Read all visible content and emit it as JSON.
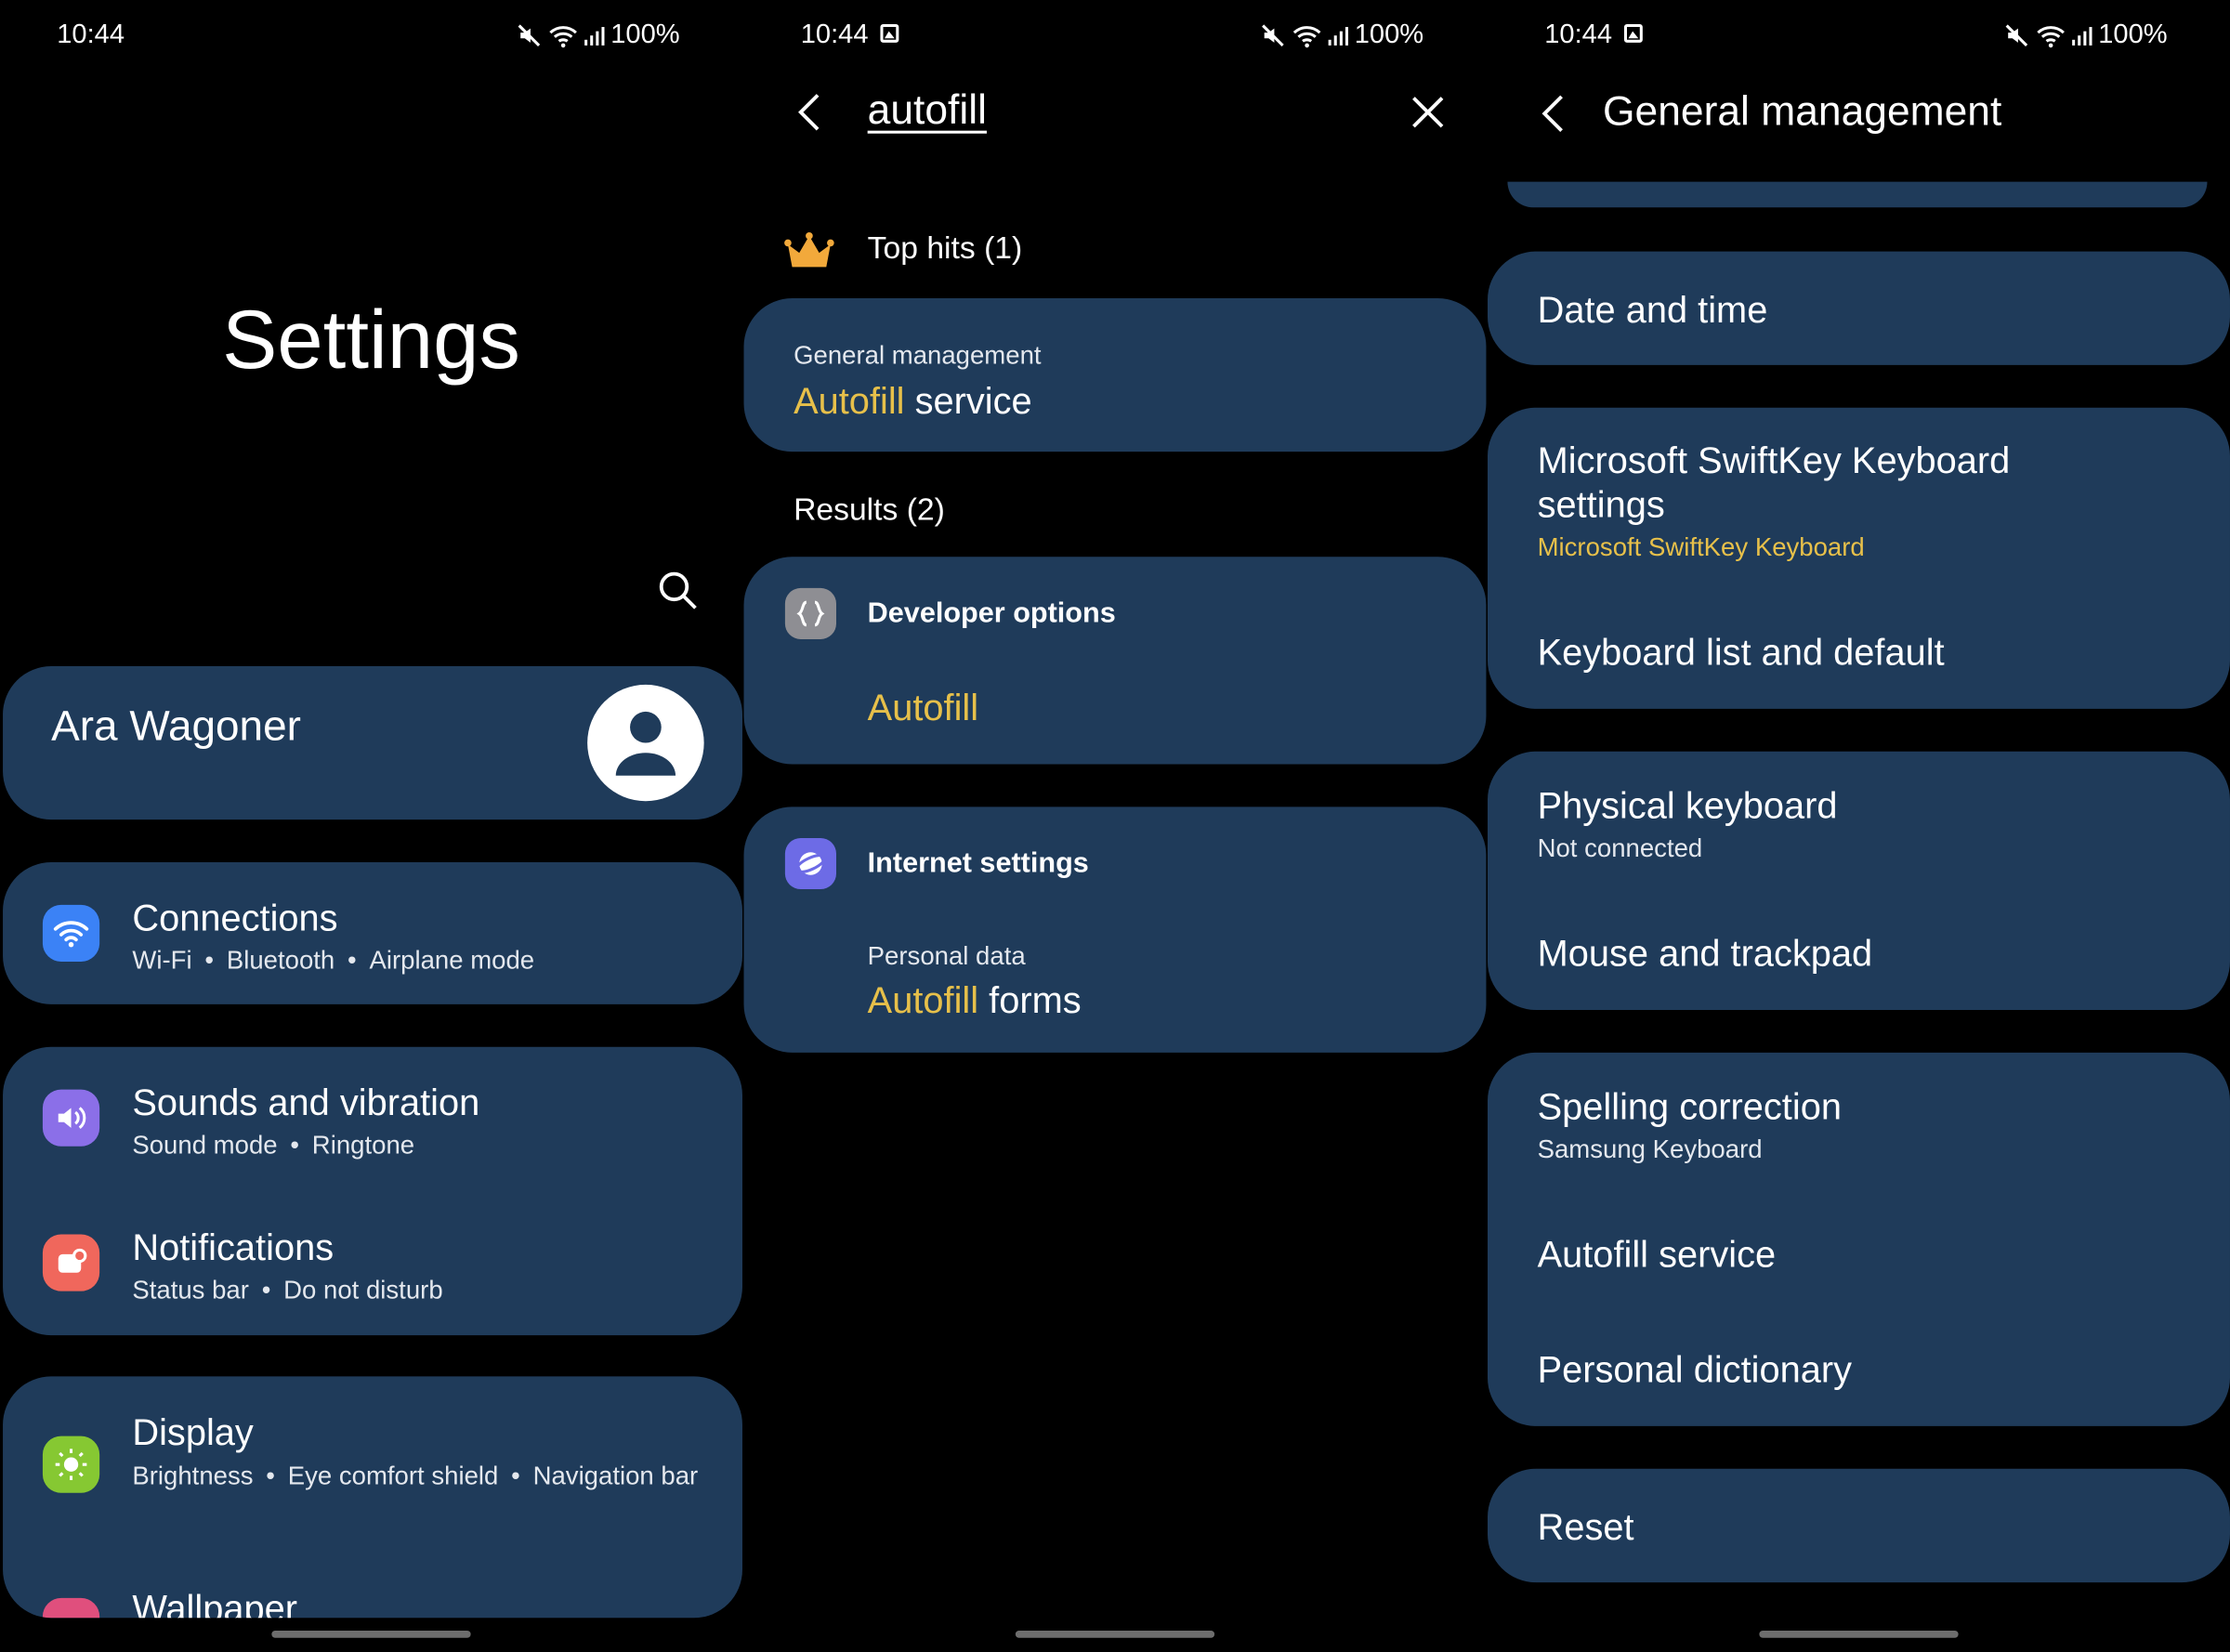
{
  "status_bar": {
    "time": "10:44",
    "battery": "100%"
  },
  "settings_panel": {
    "title": "Settings",
    "profile_name": "Ara Wagoner",
    "items": [
      {
        "title": "Connections",
        "sub": [
          "Wi-Fi",
          "Bluetooth",
          "Airplane mode"
        ],
        "icon": "wifi-icon",
        "color": "#3b82f6"
      },
      {
        "title": "Sounds and vibration",
        "sub": [
          "Sound mode",
          "Ringtone"
        ],
        "icon": "speaker-icon",
        "color": "#8b6fe8"
      },
      {
        "title": "Notifications",
        "sub": [
          "Status bar",
          "Do not disturb"
        ],
        "icon": "notification-icon",
        "color": "#f0675c"
      },
      {
        "title": "Display",
        "sub": [
          "Brightness",
          "Eye comfort shield",
          "Navigation bar"
        ],
        "icon": "sun-icon",
        "color": "#86c832"
      },
      {
        "title": "Wallpaper",
        "icon": "wallpaper-icon",
        "color": "#e04f7d"
      }
    ]
  },
  "search_panel": {
    "query": "autofill",
    "top_hits_label": "Top hits (1)",
    "top_hit": {
      "category": "General management",
      "match": "Autofill",
      "rest": " service"
    },
    "results_label": "Results (2)",
    "results": [
      {
        "source": "Developer options",
        "icon": "developer-options-icon",
        "color": "#8e8e93",
        "context": "",
        "match": "Autofill",
        "rest": ""
      },
      {
        "source": "Internet settings",
        "icon": "samsung-internet-icon",
        "color": "#6d6be6",
        "context": "Personal data",
        "match": "Autofill",
        "rest": " forms"
      }
    ]
  },
  "general_management_panel": {
    "title": "General management",
    "items": {
      "date_time": "Date and time",
      "swiftkey": "Microsoft SwiftKey Keyboard settings",
      "swiftkey_sub": "Microsoft SwiftKey Keyboard",
      "keyboard_list": "Keyboard list and default",
      "physical_keyboard": "Physical keyboard",
      "physical_keyboard_sub": "Not connected",
      "mouse": "Mouse and trackpad",
      "spelling": "Spelling correction",
      "spelling_sub": "Samsung Keyboard",
      "autofill": "Autofill service",
      "dictionary": "Personal dictionary",
      "reset": "Reset"
    }
  },
  "colors": {
    "card": "#1f3b5a",
    "highlight": "#e7c04a",
    "background": "#000000"
  }
}
